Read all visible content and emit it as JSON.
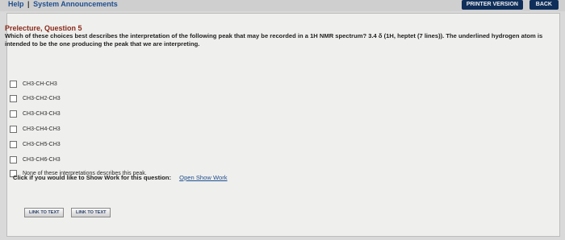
{
  "topbar": {
    "help": "Help",
    "separator": "|",
    "announcements": "System Announcements",
    "printer_version": "PRINTER VERSION",
    "back": "BACK"
  },
  "question": {
    "title": "Prelecture, Question 5",
    "text": "Which of these choices best describes the interpretation of the following peak that may be recorded in a 1H NMR spectrum? 3.4 δ (1H, heptet (7 lines)). The underlined hydrogen atom is intended to be the one producing the peak that we are interpreting."
  },
  "options": [
    "CH3-CH-CH3",
    "CH3-CH2-CH3",
    "CH3-CH3-CH3",
    "CH3-CH4-CH3",
    "CH3-CH5-CH3",
    "CH3-CH6-CH3",
    "None of these interpretations describes this peak."
  ],
  "show_work": {
    "prompt": "Click if you would like to Show Work for this question:",
    "link": "Open Show Work"
  },
  "footer": {
    "link1": "LINK TO TEXT",
    "link2": "LINK TO TEXT"
  }
}
